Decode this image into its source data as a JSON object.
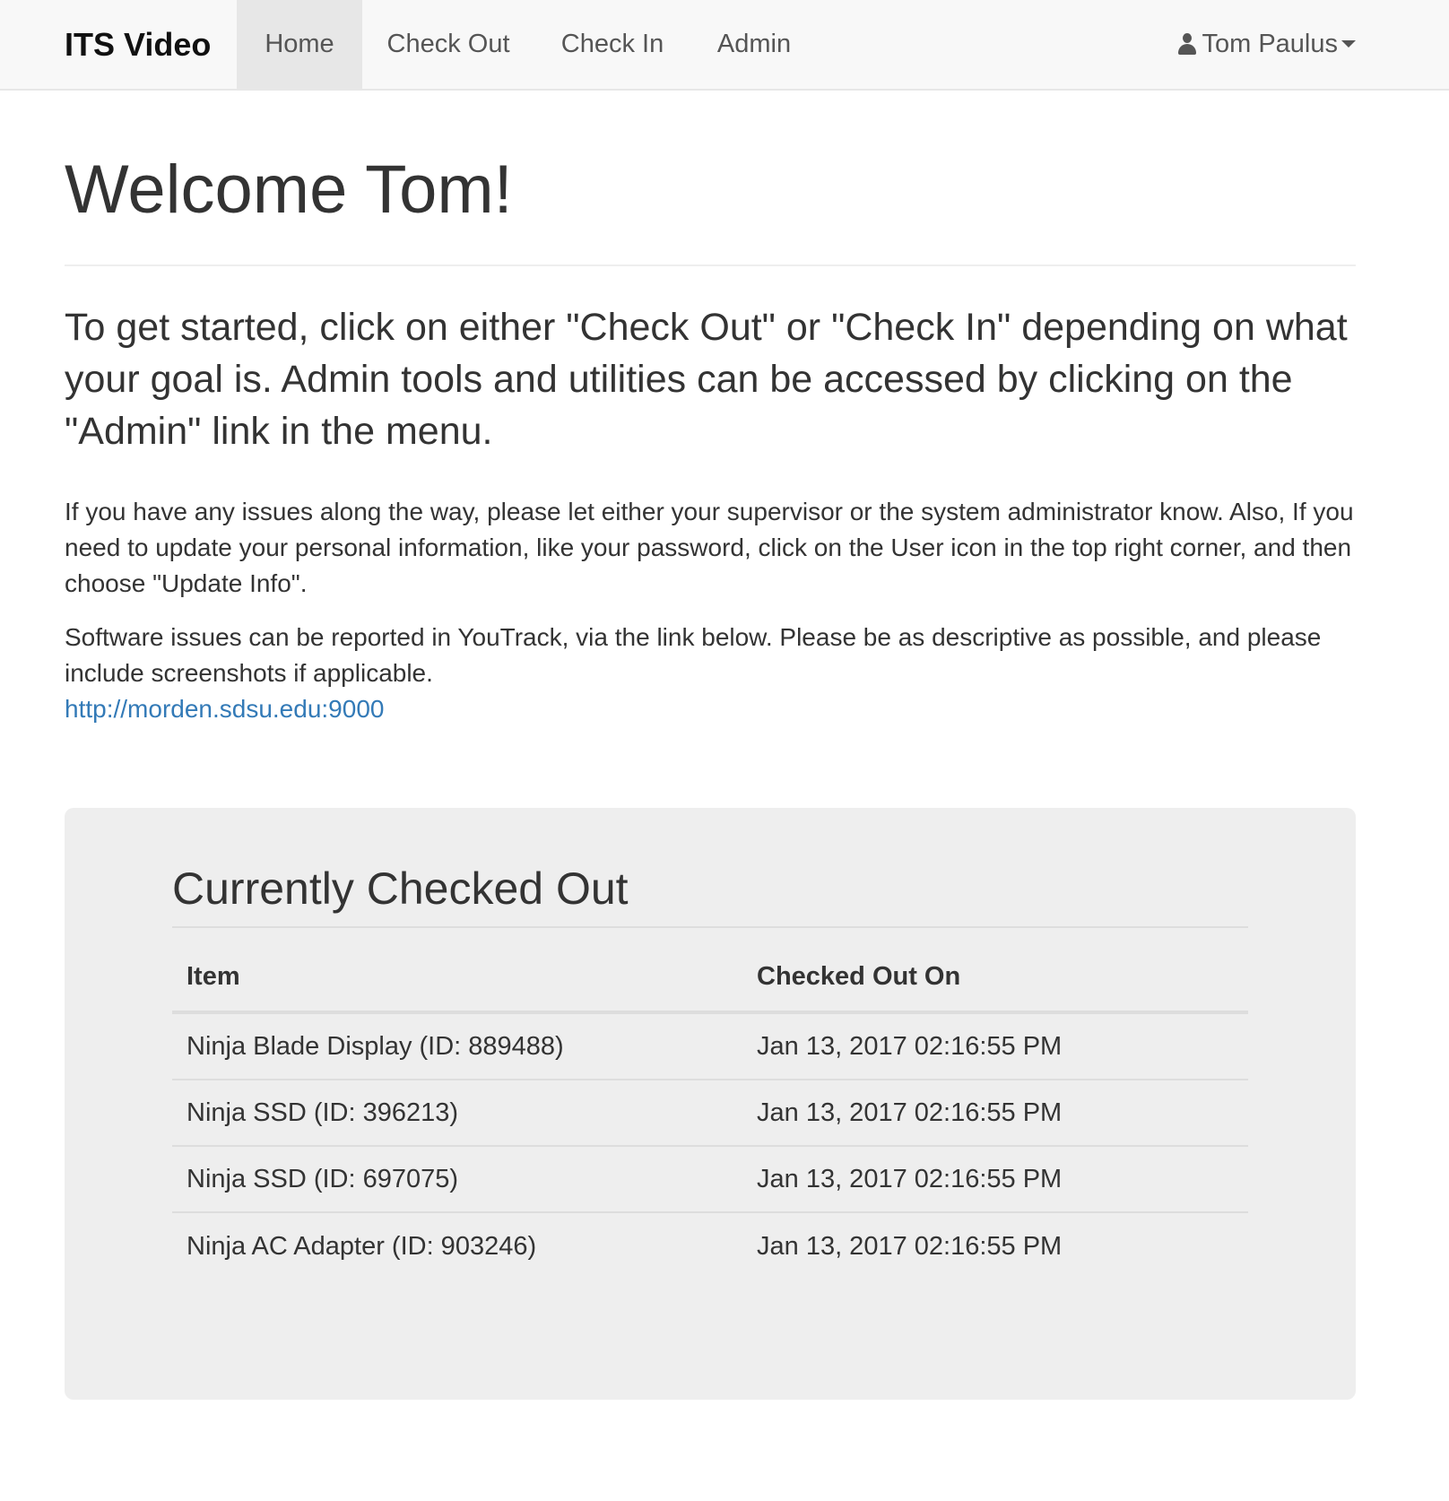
{
  "navbar": {
    "brand": "ITS Video",
    "links": [
      {
        "label": "Home",
        "active": true
      },
      {
        "label": "Check Out",
        "active": false
      },
      {
        "label": "Check In",
        "active": false
      },
      {
        "label": "Admin",
        "active": false
      }
    ],
    "user": {
      "name": "Tom Paulus",
      "icon": "user-icon",
      "dropdown_icon": "caret-down-icon"
    }
  },
  "main": {
    "title": "Welcome Tom!",
    "lead": "To get started, click on either \"Check Out\" or \"Check In\" depending on what your goal is. Admin tools and utilities can be accessed by clicking on the \"Admin\" link in the menu.",
    "para1": "If you have any issues along the way, please let either your supervisor or the system administrator know. Also, If you need to update your personal information, like your password, click on the User icon in the top right corner, and then choose \"Update Info\".",
    "para2": "Software issues can be reported in YouTrack, via the link below. Please be as descriptive as possible, and please include screenshots if applicable.",
    "link": "http://morden.sdsu.edu:9000"
  },
  "checked_out": {
    "title": "Currently Checked Out",
    "columns": [
      "Item",
      "Checked Out On"
    ],
    "rows": [
      {
        "item": "Ninja Blade Display (ID: 889488)",
        "date": "Jan 13, 2017 02:16:55 PM"
      },
      {
        "item": "Ninja SSD (ID: 396213)",
        "date": "Jan 13, 2017 02:16:55 PM"
      },
      {
        "item": "Ninja SSD (ID: 697075)",
        "date": "Jan 13, 2017 02:16:55 PM"
      },
      {
        "item": "Ninja AC Adapter (ID: 903246)",
        "date": "Jan 13, 2017 02:16:55 PM"
      }
    ]
  },
  "colors": {
    "navbar_bg": "#f8f8f8",
    "active_nav_bg": "#e7e7e7",
    "link": "#337ab7",
    "well_bg": "#eeeeee",
    "text": "#333333"
  }
}
